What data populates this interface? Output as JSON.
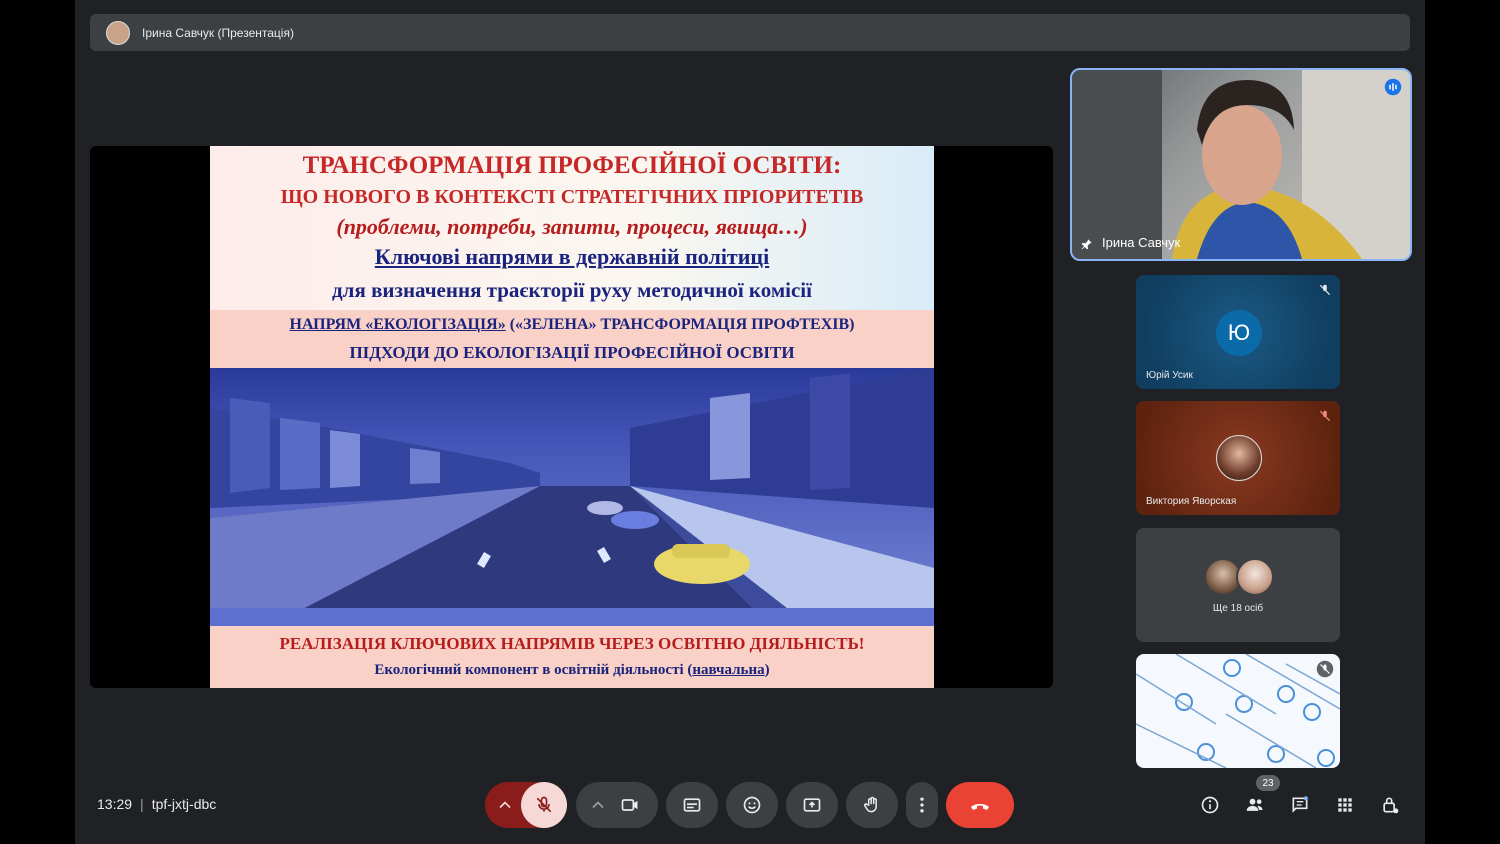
{
  "header": {
    "presenter_label": "Ірина Савчук (Презентація)"
  },
  "slide": {
    "title_line1": "ТРАНСФОРМАЦІЯ ПРОФЕСІЙНОЇ ОСВІТИ:",
    "title_line2": "ЩО НОВОГО В КОНТЕКСТІ СТРАТЕГІЧНИХ ПРІОРИТЕТІВ",
    "title_line3": "(проблеми, потреби, запити, процеси, явища…)",
    "heading": "Ключові напрями в державній політиці",
    "subheading": "для визначення траєкторії руху методичної комісії",
    "direction_main": "НАПРЯМ «ЕКОЛОГІЗАЦІЯ»",
    "direction_rest": " («ЗЕЛЕНА» ТРАНСФОРМАЦІЯ ПРОФТЕХІВ)",
    "approaches": "ПІДХОДИ ДО ЕКОЛОГІЗАЦІЇ ПРОФЕСІЙНОЇ ОСВІТИ",
    "realization": "РЕАЛІЗАЦІЯ КЛЮЧОВИХ НАПРЯМІВ ЧЕРЕЗ ОСВІТНЮ ДІЯЛЬНІСТЬ!",
    "component_main": "Екологічний компонент в освітній діяльності (",
    "component_link": "навчальна",
    "component_end": ")"
  },
  "participants": {
    "self_name": "Ірина Савчук",
    "tile1_initial": "Ю",
    "tile1_name": "Юрій Усик",
    "tile2_name": "Виктория Яворская",
    "more_label": "Ще 18 осіб"
  },
  "bottombar": {
    "time": "13:29",
    "separator": "|",
    "meeting_code": "tpf-jxtj-dbc",
    "people_count": "23"
  },
  "colors": {
    "background": "#202124",
    "control_bg": "#3c4043",
    "mic_muted_bg": "#f6d9d6",
    "end_call": "#ea4335",
    "accent": "#8ab4f8"
  },
  "icons": [
    "chevron-up-icon",
    "mic-off-icon",
    "camera-icon",
    "captions-icon",
    "emoji-icon",
    "present-icon",
    "hand-icon",
    "more-vert-icon",
    "end-call-icon",
    "info-icon",
    "people-icon",
    "chat-icon",
    "apps-icon",
    "lock-icon"
  ]
}
